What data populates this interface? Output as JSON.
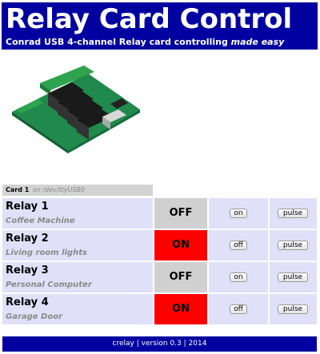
{
  "header": {
    "title": "Relay Card Control",
    "subtitle_main": "Conrad USB 4-channel Relay card controlling ",
    "subtitle_emphasis": "made easy"
  },
  "card": {
    "name": "Card 1",
    "device": "on /dev/ttyUSB0"
  },
  "relays": [
    {
      "name": "Relay 1",
      "description": "Coffee Machine",
      "state": "OFF",
      "toggle_label": "on",
      "pulse_label": "pulse"
    },
    {
      "name": "Relay 2",
      "description": "Living room lights",
      "state": "ON",
      "toggle_label": "off",
      "pulse_label": "pulse"
    },
    {
      "name": "Relay 3",
      "description": "Personal Computer",
      "state": "OFF",
      "toggle_label": "on",
      "pulse_label": "pulse"
    },
    {
      "name": "Relay 4",
      "description": "Garage Door",
      "state": "ON",
      "toggle_label": "off",
      "pulse_label": "pulse"
    }
  ],
  "colors": {
    "header_bg": "#0000a0",
    "state_on": "#ff0000",
    "state_off": "#d0d0d0",
    "row_bg": "#e0e0f8"
  },
  "footer": {
    "text": "crelay | version 0.3 | 2014"
  }
}
